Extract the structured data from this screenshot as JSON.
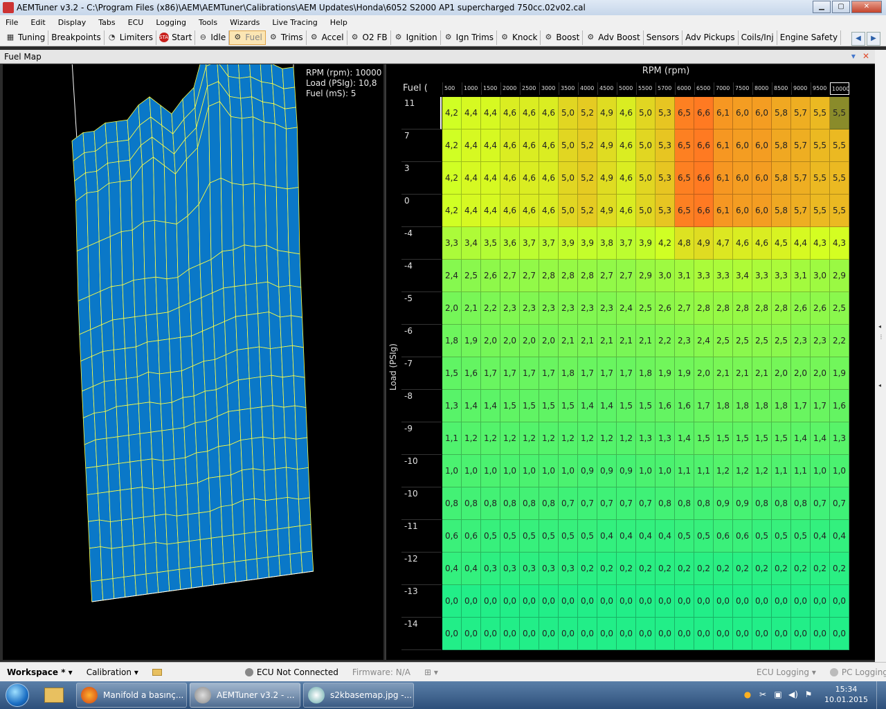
{
  "window": {
    "title": "AEMTuner v3.2 - C:\\Program Files (x86)\\AEM\\AEMTuner\\Calibrations\\AEM Updates\\Honda\\6052 S2000 AP1 supercharged 750cc.02v02.cal",
    "min": "▁",
    "max": "▢",
    "close": "✕"
  },
  "menu": [
    "File",
    "Edit",
    "Display",
    "Tabs",
    "ECU",
    "Logging",
    "Tools",
    "Wizards",
    "Live Tracing",
    "Help"
  ],
  "toolbar": [
    {
      "label": "Tuning",
      "icon": "▦",
      "active": false
    },
    {
      "label": "Breakpoints",
      "icon": "",
      "active": false
    },
    {
      "label": "Limiters",
      "icon": "◔",
      "active": false
    },
    {
      "label": "Start",
      "icon": "START",
      "active": false
    },
    {
      "label": "Idle",
      "icon": "⊖",
      "active": false
    },
    {
      "label": "Fuel",
      "icon": "⚙",
      "active": true
    },
    {
      "label": "Trims",
      "icon": "⚙",
      "active": false
    },
    {
      "label": "Accel",
      "icon": "⚙",
      "active": false
    },
    {
      "label": "O2 FB",
      "icon": "⚙",
      "active": false
    },
    {
      "label": "Ignition",
      "icon": "⚙",
      "active": false
    },
    {
      "label": "Ign Trims",
      "icon": "⚙",
      "active": false
    },
    {
      "label": "Knock",
      "icon": "⚙",
      "active": false
    },
    {
      "label": "Boost",
      "icon": "⚙",
      "active": false
    },
    {
      "label": "Adv Boost",
      "icon": "⚙",
      "active": false
    },
    {
      "label": "Sensors",
      "icon": "",
      "active": false
    },
    {
      "label": "Adv Pickups",
      "icon": "",
      "active": false
    },
    {
      "label": "Coils/Inj",
      "icon": "",
      "active": false
    },
    {
      "label": "Engine Safety",
      "icon": "",
      "active": false
    }
  ],
  "nav": {
    "left": "◀",
    "right": "▶"
  },
  "panel": {
    "title": "Fuel Map",
    "pin": "▾",
    "close": "✕"
  },
  "readout": {
    "rpm": "RPM (rpm): 10000",
    "load": "Load (PSIg): 10,8",
    "fuel": "Fuel (mS): 5"
  },
  "table": {
    "x_title": "RPM (rpm)",
    "y_title": "Load (PSIg)",
    "z_label": "Fuel (",
    "rpm": [
      "500",
      "1000",
      "1500",
      "2000",
      "2500",
      "3000",
      "3500",
      "4000",
      "4500",
      "5000",
      "5500",
      "5700",
      "6000",
      "6500",
      "7000",
      "7500",
      "8000",
      "8500",
      "9000",
      "9500",
      "10000"
    ],
    "load": [
      "11",
      "7",
      "3",
      "0",
      "-4",
      "-4",
      "-5",
      "-6",
      "-7",
      "-8",
      "-9",
      "-10",
      "-10",
      "-11",
      "-12",
      "-13",
      "-14"
    ],
    "values": [
      [
        "4,2",
        "4,4",
        "4,4",
        "4,6",
        "4,6",
        "4,6",
        "5,0",
        "5,2",
        "4,9",
        "4,6",
        "5,0",
        "5,3",
        "6,5",
        "6,6",
        "6,1",
        "6,0",
        "6,0",
        "5,8",
        "5,7",
        "5,5",
        "5,5"
      ],
      [
        "4,2",
        "4,4",
        "4,4",
        "4,6",
        "4,6",
        "4,6",
        "5,0",
        "5,2",
        "4,9",
        "4,6",
        "5,0",
        "5,3",
        "6,5",
        "6,6",
        "6,1",
        "6,0",
        "6,0",
        "5,8",
        "5,7",
        "5,5",
        "5,5"
      ],
      [
        "4,2",
        "4,4",
        "4,4",
        "4,6",
        "4,6",
        "4,6",
        "5,0",
        "5,2",
        "4,9",
        "4,6",
        "5,0",
        "5,3",
        "6,5",
        "6,6",
        "6,1",
        "6,0",
        "6,0",
        "5,8",
        "5,7",
        "5,5",
        "5,5"
      ],
      [
        "4,2",
        "4,4",
        "4,4",
        "4,6",
        "4,6",
        "4,6",
        "5,0",
        "5,2",
        "4,9",
        "4,6",
        "5,0",
        "5,3",
        "6,5",
        "6,6",
        "6,1",
        "6,0",
        "6,0",
        "5,8",
        "5,7",
        "5,5",
        "5,5"
      ],
      [
        "3,3",
        "3,4",
        "3,5",
        "3,6",
        "3,7",
        "3,7",
        "3,9",
        "3,9",
        "3,8",
        "3,7",
        "3,9",
        "4,2",
        "4,8",
        "4,9",
        "4,7",
        "4,6",
        "4,6",
        "4,5",
        "4,4",
        "4,3",
        "4,3"
      ],
      [
        "2,4",
        "2,5",
        "2,6",
        "2,7",
        "2,7",
        "2,8",
        "2,8",
        "2,8",
        "2,7",
        "2,7",
        "2,9",
        "3,0",
        "3,1",
        "3,3",
        "3,3",
        "3,4",
        "3,3",
        "3,3",
        "3,1",
        "3,0",
        "2,9"
      ],
      [
        "2,0",
        "2,1",
        "2,2",
        "2,3",
        "2,3",
        "2,3",
        "2,3",
        "2,3",
        "2,3",
        "2,4",
        "2,5",
        "2,6",
        "2,7",
        "2,8",
        "2,8",
        "2,8",
        "2,8",
        "2,8",
        "2,6",
        "2,6",
        "2,5"
      ],
      [
        "1,8",
        "1,9",
        "2,0",
        "2,0",
        "2,0",
        "2,0",
        "2,1",
        "2,1",
        "2,1",
        "2,1",
        "2,1",
        "2,2",
        "2,3",
        "2,4",
        "2,5",
        "2,5",
        "2,5",
        "2,5",
        "2,3",
        "2,3",
        "2,2"
      ],
      [
        "1,5",
        "1,6",
        "1,7",
        "1,7",
        "1,7",
        "1,7",
        "1,8",
        "1,7",
        "1,7",
        "1,7",
        "1,8",
        "1,9",
        "1,9",
        "2,0",
        "2,1",
        "2,1",
        "2,1",
        "2,0",
        "2,0",
        "2,0",
        "1,9"
      ],
      [
        "1,3",
        "1,4",
        "1,4",
        "1,5",
        "1,5",
        "1,5",
        "1,5",
        "1,4",
        "1,4",
        "1,5",
        "1,5",
        "1,6",
        "1,6",
        "1,7",
        "1,8",
        "1,8",
        "1,8",
        "1,8",
        "1,7",
        "1,7",
        "1,6"
      ],
      [
        "1,1",
        "1,2",
        "1,2",
        "1,2",
        "1,2",
        "1,2",
        "1,2",
        "1,2",
        "1,2",
        "1,2",
        "1,3",
        "1,3",
        "1,4",
        "1,5",
        "1,5",
        "1,5",
        "1,5",
        "1,5",
        "1,4",
        "1,4",
        "1,3"
      ],
      [
        "1,0",
        "1,0",
        "1,0",
        "1,0",
        "1,0",
        "1,0",
        "1,0",
        "0,9",
        "0,9",
        "0,9",
        "1,0",
        "1,0",
        "1,1",
        "1,1",
        "1,2",
        "1,2",
        "1,2",
        "1,1",
        "1,1",
        "1,0",
        "1,0"
      ],
      [
        "0,8",
        "0,8",
        "0,8",
        "0,8",
        "0,8",
        "0,8",
        "0,7",
        "0,7",
        "0,7",
        "0,7",
        "0,7",
        "0,8",
        "0,8",
        "0,8",
        "0,9",
        "0,9",
        "0,8",
        "0,8",
        "0,8",
        "0,7",
        "0,7"
      ],
      [
        "0,6",
        "0,6",
        "0,5",
        "0,5",
        "0,5",
        "0,5",
        "0,5",
        "0,5",
        "0,4",
        "0,4",
        "0,4",
        "0,4",
        "0,5",
        "0,5",
        "0,6",
        "0,6",
        "0,5",
        "0,5",
        "0,5",
        "0,4",
        "0,4"
      ],
      [
        "0,4",
        "0,4",
        "0,3",
        "0,3",
        "0,3",
        "0,3",
        "0,3",
        "0,2",
        "0,2",
        "0,2",
        "0,2",
        "0,2",
        "0,2",
        "0,2",
        "0,2",
        "0,2",
        "0,2",
        "0,2",
        "0,2",
        "0,2",
        "0,2"
      ],
      [
        "0,0",
        "0,0",
        "0,0",
        "0,0",
        "0,0",
        "0,0",
        "0,0",
        "0,0",
        "0,0",
        "0,0",
        "0,0",
        "0,0",
        "0,0",
        "0,0",
        "0,0",
        "0,0",
        "0,0",
        "0,0",
        "0,0",
        "0,0",
        "0,0"
      ],
      [
        "0,0",
        "0,0",
        "0,0",
        "0,0",
        "0,0",
        "0,0",
        "0,0",
        "0,0",
        "0,0",
        "0,0",
        "0,0",
        "0,0",
        "0,0",
        "0,0",
        "0,0",
        "0,0",
        "0,0",
        "0,0",
        "0,0",
        "0,0",
        "0,0"
      ]
    ],
    "selected_row": 0,
    "selected_col": 20,
    "value_range": [
      0,
      6.6
    ],
    "colors": {
      "low": "#22ee88",
      "mid": "#d4ff22",
      "high": "#ff7a22",
      "selected": "#8a8b2a"
    }
  },
  "surface": {
    "fill": "#0a78c8",
    "mesh": "#ffff44",
    "box": "#ffffff"
  },
  "status": {
    "workspace": "Workspace *",
    "calibration": "Calibration",
    "ecu": "ECU Not Connected",
    "firmware": "Firmware: N/A",
    "ecu_logging": "ECU Logging",
    "pc_logging": "PC Logging: Off"
  },
  "taskbar": {
    "tasks": [
      "Manifold a basınç...",
      "AEMTuner v3.2 - ...",
      "s2kbasemap.jpg -..."
    ],
    "time": "15:34",
    "date": "10.01.2015"
  }
}
